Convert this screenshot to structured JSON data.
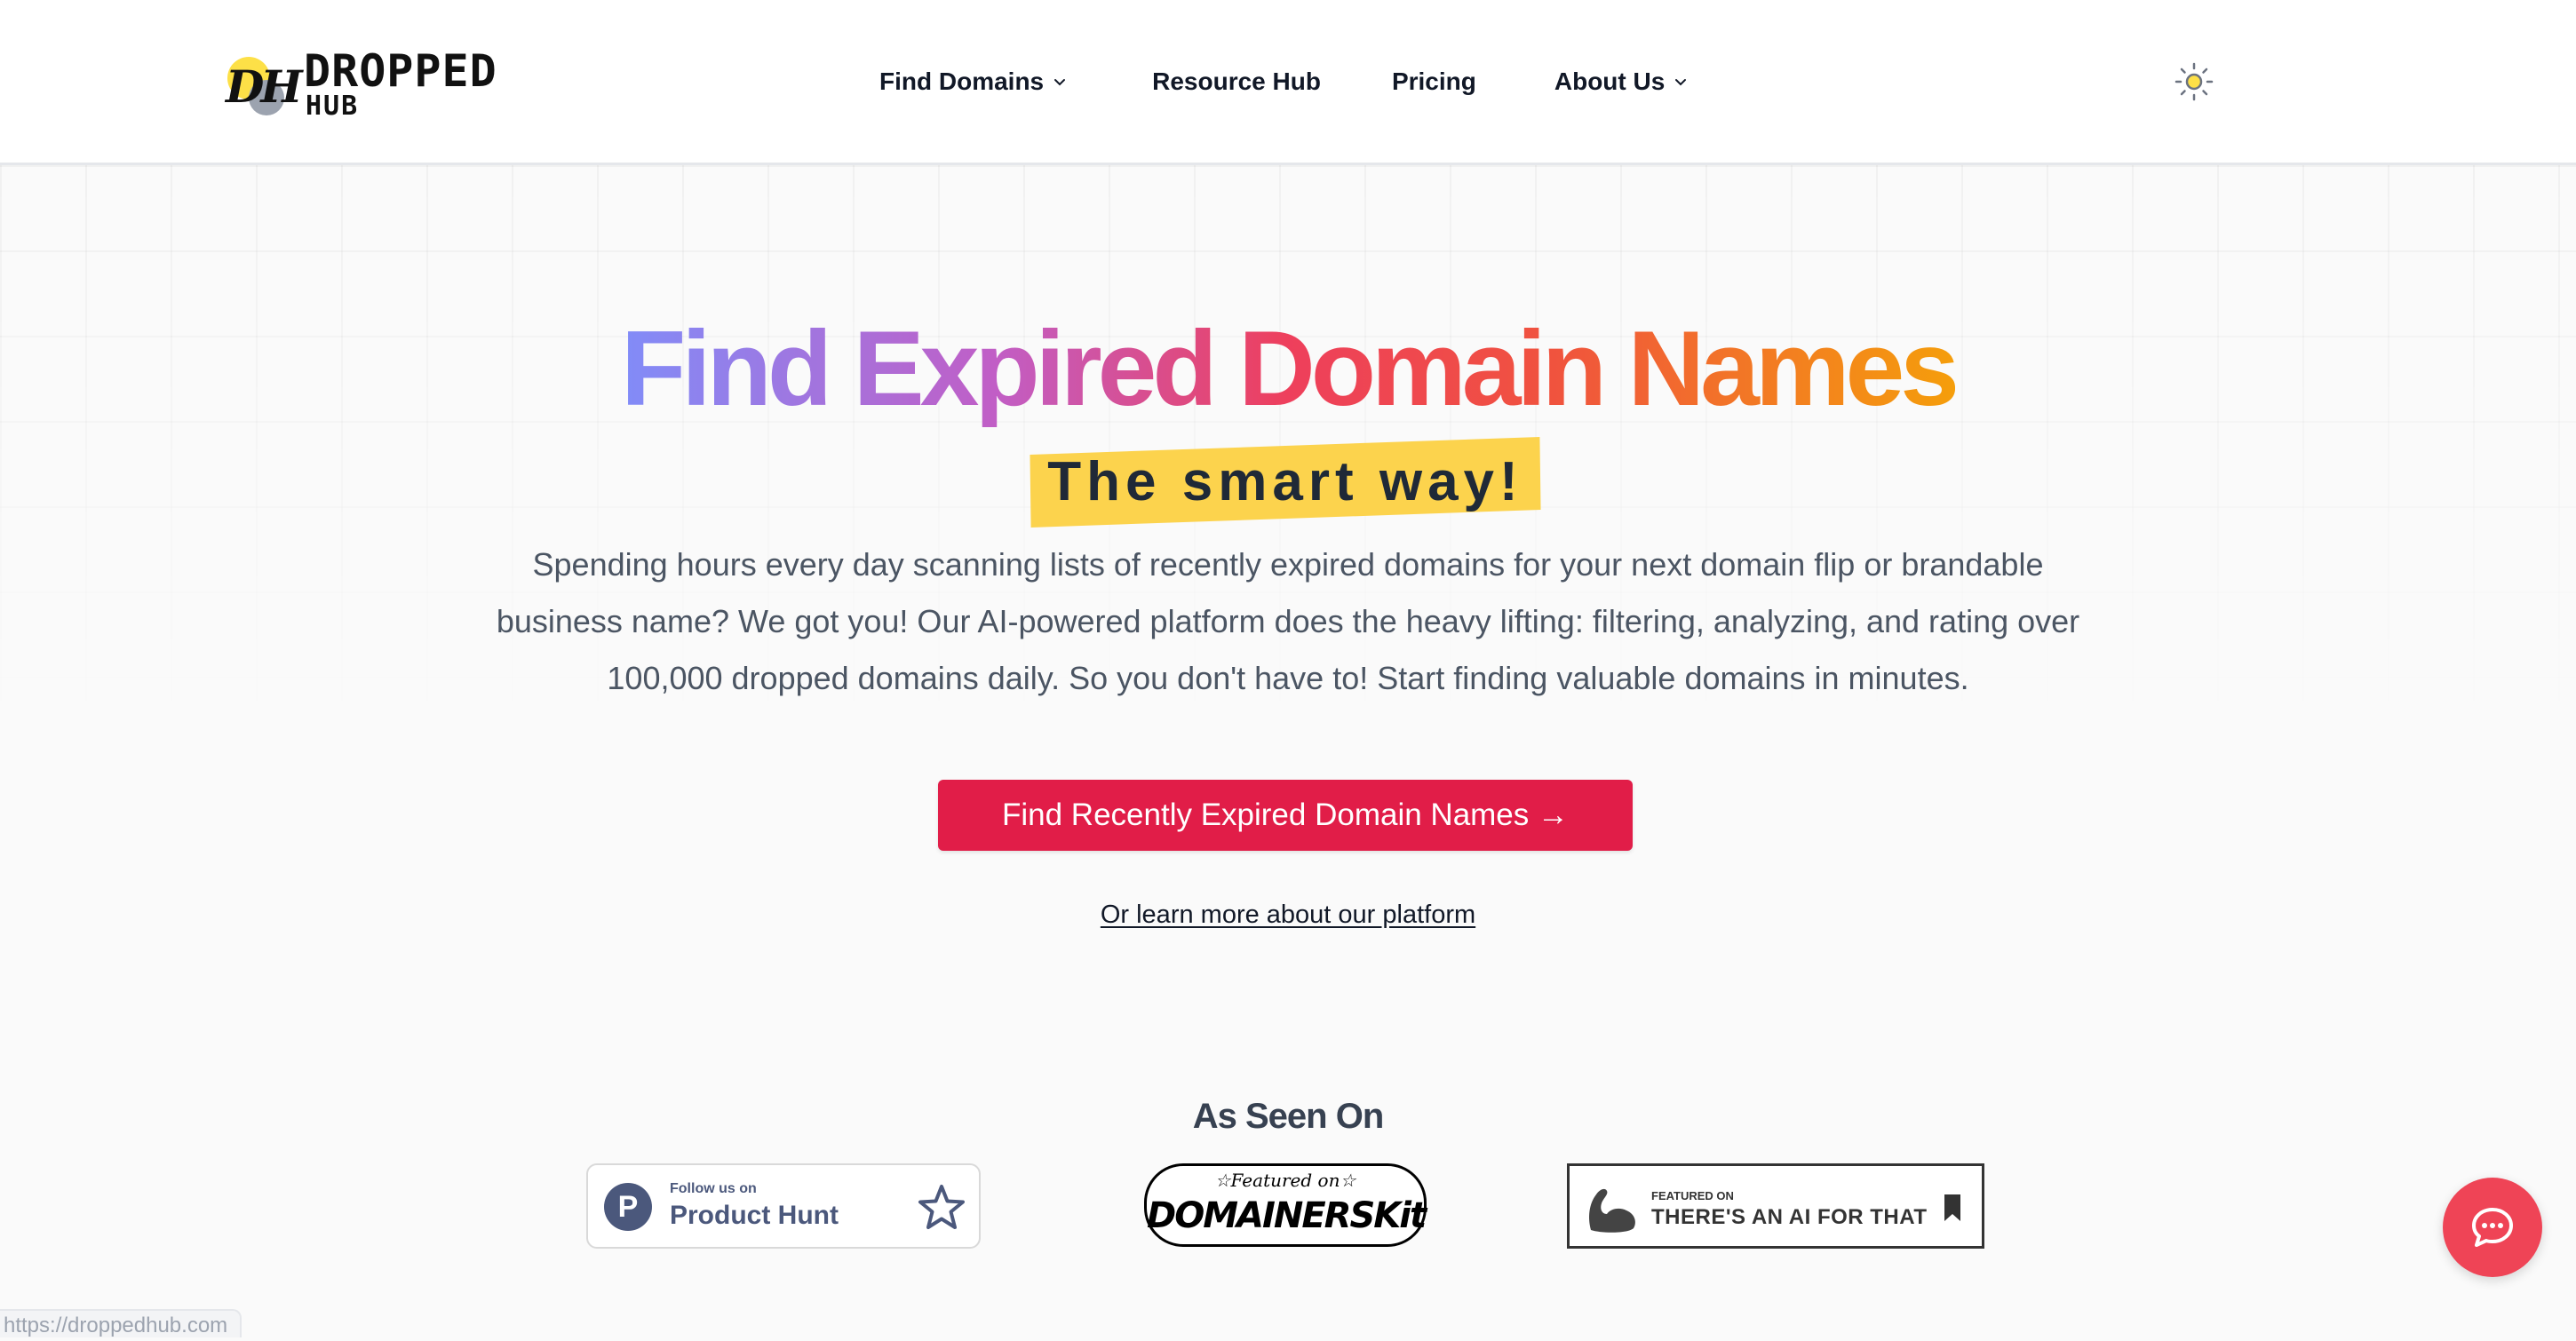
{
  "brand": {
    "logo_mark": "DH",
    "name_line1": "DROPPED",
    "name_line2": "HUB"
  },
  "nav": {
    "items": [
      {
        "label": "Find Domains",
        "has_dropdown": true
      },
      {
        "label": "Resource Hub",
        "has_dropdown": false
      },
      {
        "label": "Pricing",
        "has_dropdown": false
      },
      {
        "label": "About Us",
        "has_dropdown": true
      }
    ],
    "theme_icon": "sun-icon"
  },
  "hero": {
    "title": "Find Expired Domain Names",
    "tagline": "The smart way!",
    "description": "Spending hours every day scanning lists of recently expired domains for your next domain flip or brandable business name? We got you! Our AI-powered platform does the heavy lifting: filtering, analyzing, and rating over 100,000 dropped domains daily. So you don't have to! Start finding valuable domains in minutes.",
    "cta_label": "Find Recently Expired Domain Names →",
    "learn_more_label": "Or learn more about our platform"
  },
  "as_seen_on": {
    "title": "As Seen On",
    "badges": {
      "product_hunt": {
        "small": "Follow us on",
        "big": "Product Hunt",
        "logo_letter": "P",
        "icon": "star-icon"
      },
      "domainerskit": {
        "small": "☆Featured on☆",
        "big": "DOMAINERSKit"
      },
      "aiforthat": {
        "small": "FEATURED ON",
        "big": "THERE'S AN AI FOR THAT",
        "icon": "bookmark-icon"
      }
    }
  },
  "chat": {
    "icon": "chat-bubble-icon"
  },
  "status_bar": {
    "url": "https://droppedhub.com"
  },
  "colors": {
    "accent": "#e11d48",
    "tagline_highlight": "#fcd34d",
    "chat": "#ef4456",
    "gradient": [
      "#818cf8",
      "#c15ec6",
      "#ee3f5c",
      "#f0533e",
      "#f59e0b"
    ]
  }
}
